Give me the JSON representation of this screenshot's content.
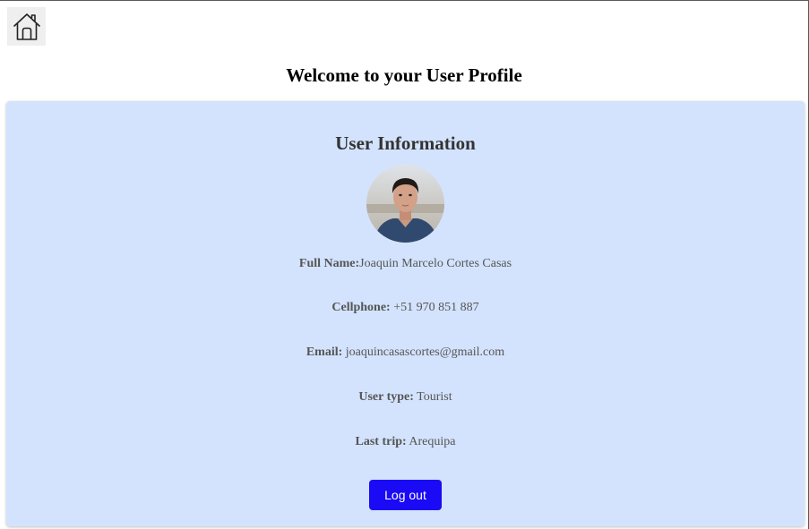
{
  "header": {
    "home_icon": "home-icon",
    "title": "Welcome to your User Profile"
  },
  "card": {
    "title": "User Information",
    "avatar": "profile-photo",
    "fields": [
      {
        "label": "Full Name:",
        "value": "Joaquin Marcelo Cortes Casas"
      },
      {
        "label": "Cellphone:",
        "value": " +51 970 851 887"
      },
      {
        "label": "Email:",
        "value": " joaquincasascortes@gmail.com"
      },
      {
        "label": "User type:",
        "value": " Tourist"
      },
      {
        "label": "Last trip:",
        "value": " Arequipa"
      }
    ],
    "logout_label": "Log out"
  },
  "colors": {
    "card_background": "#d3e3fd",
    "button_background": "#1a0af5",
    "button_text": "#ffffff"
  }
}
